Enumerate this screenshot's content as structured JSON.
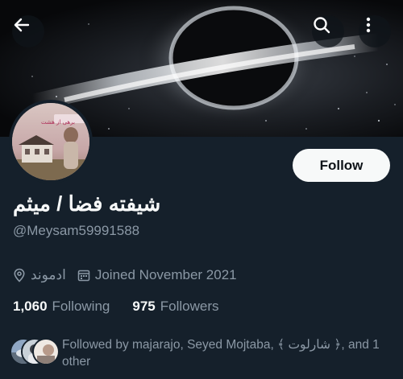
{
  "header": {
    "back_icon": "arrow-left-icon",
    "search_icon": "search-icon",
    "more_icon": "more-vertical-icon"
  },
  "profile": {
    "avatar_text": "برهی از هشت",
    "display_name": "شیفته فضا / میثم",
    "handle": "@Meysam59991588",
    "follow_label": "Follow",
    "location": "ادموند",
    "joined": "Joined November 2021",
    "following_count": "1,060",
    "following_label": "Following",
    "followers_count": "975",
    "followers_label": "Followers",
    "followed_by": "Followed by majarajo, Seyed Mojtaba, ﴾ شارلوت ﴿, and 1 other"
  },
  "colors": {
    "background": "#15202b",
    "text_primary": "#f7f9f9",
    "text_secondary": "#8b98a5",
    "button_bg": "#f7f9f9",
    "button_text": "#0f1419"
  }
}
